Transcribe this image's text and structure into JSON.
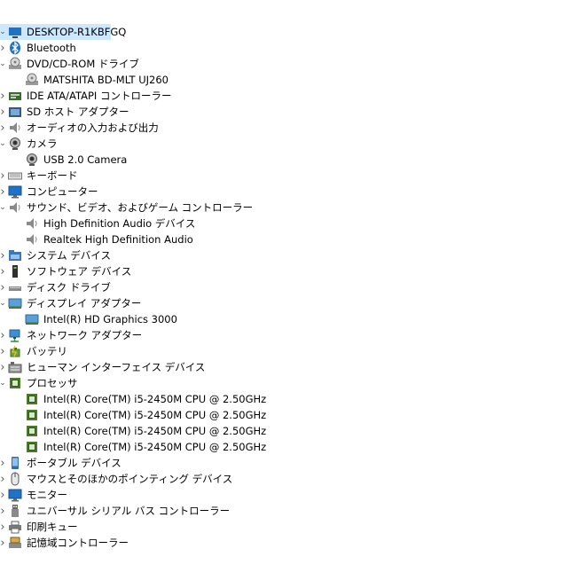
{
  "tree": {
    "root": {
      "label": "DESKTOP-R1KBFGQ",
      "icon": "computer-icon",
      "state": "expanded"
    },
    "items": [
      {
        "label": "Bluetooth",
        "icon": "bluetooth-icon",
        "state": "collapsed",
        "level": 1
      },
      {
        "label": "DVD/CD-ROM ドライブ",
        "icon": "dvd-drive-icon",
        "state": "expanded",
        "level": 1
      },
      {
        "label": "MATSHITA BD-MLT UJ260",
        "icon": "dvd-drive-icon",
        "state": "leaf",
        "level": 2
      },
      {
        "label": "IDE ATA/ATAPI コントローラー",
        "icon": "ide-controller-icon",
        "state": "collapsed",
        "level": 1
      },
      {
        "label": "SD ホスト アダプター",
        "icon": "sd-host-icon",
        "state": "collapsed",
        "level": 1
      },
      {
        "label": "オーディオの入力および出力",
        "icon": "speaker-icon",
        "state": "collapsed",
        "level": 1
      },
      {
        "label": "カメラ",
        "icon": "camera-icon",
        "state": "expanded",
        "level": 1
      },
      {
        "label": "USB 2.0 Camera",
        "icon": "camera-icon",
        "state": "leaf",
        "level": 2
      },
      {
        "label": "キーボード",
        "icon": "keyboard-icon",
        "state": "collapsed",
        "level": 1
      },
      {
        "label": "コンピューター",
        "icon": "monitor-icon",
        "state": "collapsed",
        "level": 1
      },
      {
        "label": "サウンド、ビデオ、およびゲーム コントローラー",
        "icon": "speaker-icon",
        "state": "expanded",
        "level": 1
      },
      {
        "label": "High Definition Audio デバイス",
        "icon": "speaker-icon",
        "state": "leaf",
        "level": 2
      },
      {
        "label": "Realtek High Definition Audio",
        "icon": "speaker-icon",
        "state": "leaf",
        "level": 2
      },
      {
        "label": "システム デバイス",
        "icon": "system-folder-icon",
        "state": "collapsed",
        "level": 1
      },
      {
        "label": "ソフトウェア デバイス",
        "icon": "software-device-icon",
        "state": "collapsed",
        "level": 1
      },
      {
        "label": "ディスク ドライブ",
        "icon": "disk-drive-icon",
        "state": "collapsed",
        "level": 1
      },
      {
        "label": "ディスプレイ アダプター",
        "icon": "display-adapter-icon",
        "state": "expanded",
        "level": 1
      },
      {
        "label": "Intel(R) HD Graphics 3000",
        "icon": "display-adapter-icon",
        "state": "leaf",
        "level": 2
      },
      {
        "label": "ネットワーク アダプター",
        "icon": "network-adapter-icon",
        "state": "collapsed",
        "level": 1
      },
      {
        "label": "バッテリ",
        "icon": "battery-icon",
        "state": "collapsed",
        "level": 1
      },
      {
        "label": "ヒューマン インターフェイス デバイス",
        "icon": "hid-icon",
        "state": "collapsed",
        "level": 1
      },
      {
        "label": "プロセッサ",
        "icon": "processor-icon",
        "state": "expanded",
        "level": 1
      },
      {
        "label": "Intel(R) Core(TM) i5-2450M CPU @ 2.50GHz",
        "icon": "processor-icon",
        "state": "leaf",
        "level": 2
      },
      {
        "label": "Intel(R) Core(TM) i5-2450M CPU @ 2.50GHz",
        "icon": "processor-icon",
        "state": "leaf",
        "level": 2
      },
      {
        "label": "Intel(R) Core(TM) i5-2450M CPU @ 2.50GHz",
        "icon": "processor-icon",
        "state": "leaf",
        "level": 2
      },
      {
        "label": "Intel(R) Core(TM) i5-2450M CPU @ 2.50GHz",
        "icon": "processor-icon",
        "state": "leaf",
        "level": 2
      },
      {
        "label": "ポータブル デバイス",
        "icon": "portable-device-icon",
        "state": "collapsed",
        "level": 1
      },
      {
        "label": "マウスとそのほかのポインティング デバイス",
        "icon": "mouse-icon",
        "state": "collapsed",
        "level": 1
      },
      {
        "label": "モニター",
        "icon": "monitor-icon",
        "state": "collapsed",
        "level": 1
      },
      {
        "label": "ユニバーサル シリアル バス コントローラー",
        "icon": "usb-icon",
        "state": "collapsed",
        "level": 1
      },
      {
        "label": "印刷キュー",
        "icon": "printer-icon",
        "state": "collapsed",
        "level": 1
      },
      {
        "label": "記憶域コントローラー",
        "icon": "storage-controller-icon",
        "state": "collapsed",
        "level": 1
      }
    ]
  },
  "colors": {
    "selection": "#cce8ff",
    "caret": "#555555",
    "icon_blue": "#1e73c8",
    "icon_gray": "#7a7a7a",
    "chip_green": "#4a7a2a"
  }
}
